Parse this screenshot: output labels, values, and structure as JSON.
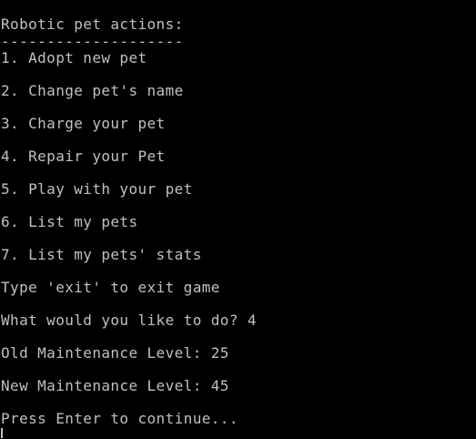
{
  "console": {
    "colors": {
      "background": "#000000",
      "text": "#c0c0c0"
    },
    "title": "Robotic pet actions:",
    "separator": "--------------------",
    "menu": [
      "1. Adopt new pet",
      "2. Change pet's name",
      "3. Charge your pet",
      "4. Repair your Pet",
      "5. Play with your pet",
      "6. List my pets",
      "7. List my pets' stats"
    ],
    "exit_hint": "Type 'exit' to exit game",
    "prompt": "What would you like to do? 4",
    "old_level": "Old Maintenance Level: 25",
    "new_level": "New Maintenance Level: 45",
    "continue_prompt": "Press Enter to continue..."
  }
}
